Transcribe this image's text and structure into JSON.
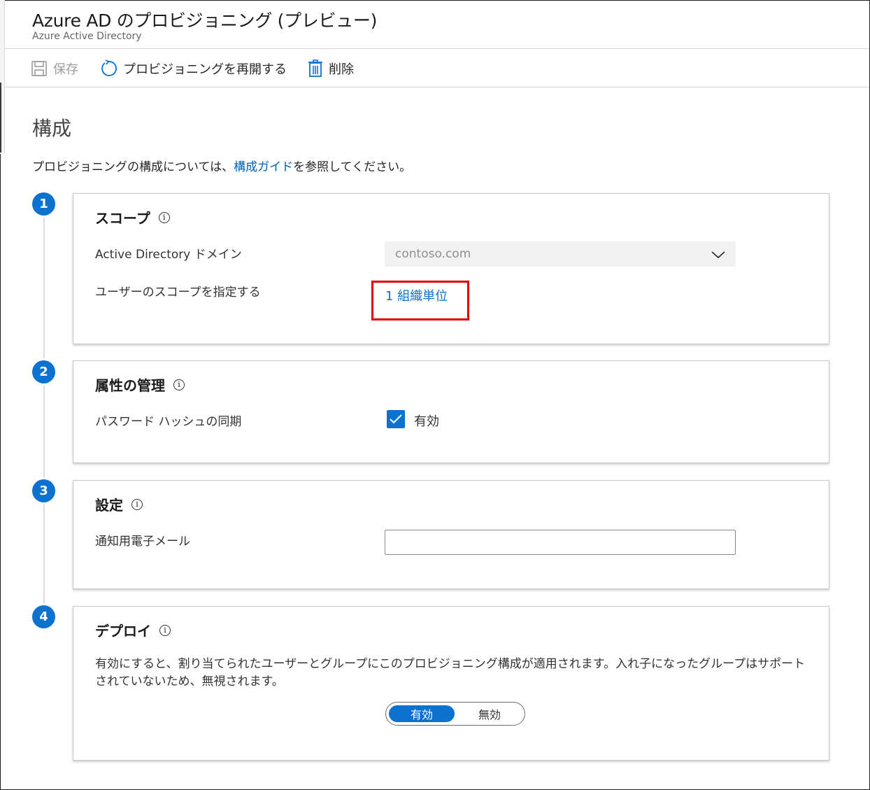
{
  "header": {
    "title": "Azure AD のプロビジョニング (プレビュー)",
    "subtitle": "Azure Active Directory"
  },
  "toolbar": {
    "save_label": "保存",
    "restart_label": "プロビジョニングを再開する",
    "delete_label": "削除"
  },
  "main": {
    "section_title": "構成",
    "intro_before": "プロビジョニングの構成については、",
    "intro_link": "構成ガイド",
    "intro_after": "を参照してください。"
  },
  "steps": [
    {
      "number": "1",
      "title": "スコープ",
      "domain_label": "Active Directory ドメイン",
      "domain_value": "contoso.com",
      "user_scope_label": "ユーザーのスコープを指定する",
      "user_scope_link": "1 組織単位"
    },
    {
      "number": "2",
      "title": "属性の管理",
      "phs_label": "パスワード ハッシュの同期",
      "phs_checkbox_label": "有効",
      "phs_checked": true
    },
    {
      "number": "3",
      "title": "設定",
      "email_label": "通知用電子メール",
      "email_value": ""
    },
    {
      "number": "4",
      "title": "デプロイ",
      "description": "有効にすると、割り当てられたユーザーとグループにこのプロビジョニング構成が適用されます。入れ子になったグループはサポートされていないため、無視されます。",
      "toggle_on": "有効",
      "toggle_off": "無効",
      "toggle_selected": "有効"
    }
  ],
  "colors": {
    "accent": "#0b72d0",
    "highlight": "#e00000",
    "link": "#0063b1"
  },
  "icons": [
    "save-icon",
    "refresh-icon",
    "trash-icon",
    "info-icon",
    "chevron-down-icon",
    "checkmark-icon"
  ]
}
